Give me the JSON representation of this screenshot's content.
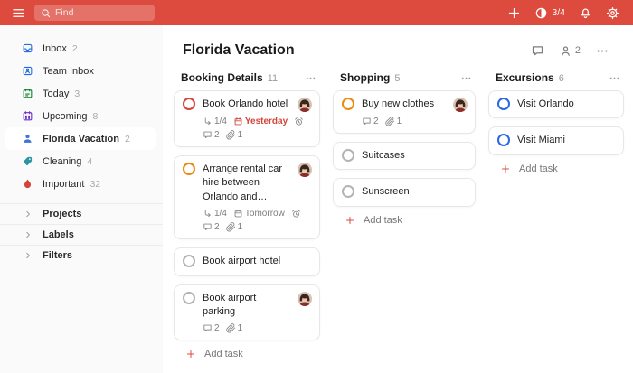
{
  "topbar": {
    "search_placeholder": "Find",
    "karma": "3/4"
  },
  "colors": {
    "brand_red": "#dd4b3e",
    "overdue_red": "#d1453b",
    "priority": {
      "p1": "#d1453b",
      "p2": "#eb8909",
      "p3": "#2a67e2",
      "none": "#b3b3b3"
    }
  },
  "sidebar": {
    "items": [
      {
        "label": "Inbox",
        "count": "2",
        "icon": "inbox-icon",
        "color": "#246fe0"
      },
      {
        "label": "Team Inbox",
        "count": "",
        "icon": "team-inbox-icon",
        "color": "#246fe0"
      },
      {
        "label": "Today",
        "count": "3",
        "icon": "today-icon",
        "color": "#058527"
      },
      {
        "label": "Upcoming",
        "count": "8",
        "icon": "upcoming-icon",
        "color": "#692ec2"
      },
      {
        "label": "Florida Vacation",
        "count": "2",
        "icon": "shared-project-icon",
        "color": "#4073d6",
        "selected": true
      },
      {
        "label": "Cleaning",
        "count": "4",
        "icon": "label-icon",
        "color": "#2a96a2"
      },
      {
        "label": "Important",
        "count": "32",
        "icon": "flame-icon",
        "color": "#d1453b"
      }
    ],
    "groups": [
      {
        "label": "Projects"
      },
      {
        "label": "Labels"
      },
      {
        "label": "Filters"
      }
    ]
  },
  "main": {
    "title": "Florida Vacation",
    "members_count": "2",
    "add_task_label": "Add task",
    "columns": [
      {
        "name": "Booking Details",
        "count": "11",
        "tasks": [
          {
            "title": "Book Orlando hotel",
            "priority": "p1",
            "avatar": true,
            "subtasks": "1/4",
            "due": "Yesterday",
            "due_overdue": true,
            "reminder": true,
            "comments": "2",
            "attachments": "1"
          },
          {
            "title": "Arrange rental car hire between Orlando and…",
            "priority": "p2",
            "avatar": true,
            "subtasks": "1/4",
            "due": "Tomorrow",
            "due_overdue": false,
            "reminder": true,
            "comments": "2",
            "attachments": "1"
          },
          {
            "title": "Book airport hotel",
            "priority": "none",
            "avatar": false
          },
          {
            "title": "Book airport parking",
            "priority": "none",
            "avatar": true,
            "comments": "2",
            "attachments": "1"
          }
        ]
      },
      {
        "name": "Shopping",
        "count": "5",
        "tasks": [
          {
            "title": "Buy new clothes",
            "priority": "p2",
            "avatar": true,
            "comments": "2",
            "attachments": "1"
          },
          {
            "title": "Suitcases",
            "priority": "none"
          },
          {
            "title": "Sunscreen",
            "priority": "none"
          }
        ]
      },
      {
        "name": "Excursions",
        "count": "6",
        "tasks": [
          {
            "title": "Visit Orlando",
            "priority": "p3"
          },
          {
            "title": "Visit Miami",
            "priority": "p3"
          }
        ]
      }
    ]
  }
}
